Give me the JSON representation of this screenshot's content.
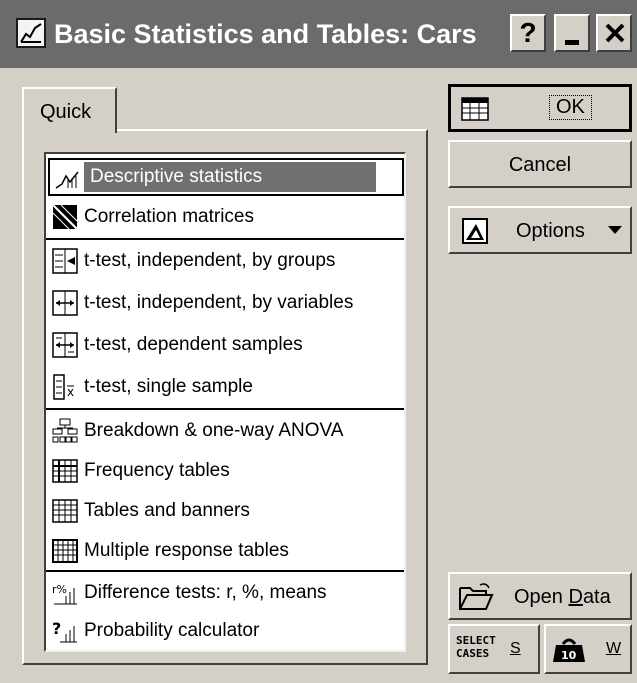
{
  "window": {
    "title": "Basic Statistics and Tables: Cars",
    "help_label": "?",
    "icon": "statistics-app-icon"
  },
  "tabs": [
    {
      "label": "Quick",
      "active": true
    }
  ],
  "list": {
    "groups": [
      [
        {
          "label": "Descriptive statistics",
          "icon": "descriptive-stats-icon",
          "selected": true
        },
        {
          "label": "Correlation matrices",
          "icon": "correlation-matrix-icon"
        }
      ],
      [
        {
          "label": "t-test, independent, by groups",
          "icon": "ttest-groups-icon"
        },
        {
          "label": "t-test, independent, by variables",
          "icon": "ttest-variables-icon"
        },
        {
          "label": "t-test, dependent samples",
          "icon": "ttest-dependent-icon"
        },
        {
          "label": "t-test, single sample",
          "icon": "ttest-single-icon"
        }
      ],
      [
        {
          "label": "Breakdown & one-way ANOVA",
          "icon": "breakdown-anova-icon"
        },
        {
          "label": "Frequency tables",
          "icon": "frequency-table-icon"
        },
        {
          "label": "Tables and banners",
          "icon": "tables-banners-icon"
        },
        {
          "label": "Multiple response tables",
          "icon": "multiple-response-icon"
        }
      ],
      [
        {
          "label": "Difference tests: r, %, means",
          "icon": "difference-tests-icon"
        },
        {
          "label": "Probability calculator",
          "icon": "probability-calculator-icon"
        }
      ]
    ]
  },
  "buttons": {
    "ok": "OK",
    "cancel": "Cancel",
    "options": "Options",
    "open_data_pre": "Open ",
    "open_data_ul": "D",
    "open_data_post": "ata",
    "select_cases_line1": "SELECT",
    "select_cases_line2": "CASES",
    "select_key": "S",
    "weight_key": "W"
  }
}
